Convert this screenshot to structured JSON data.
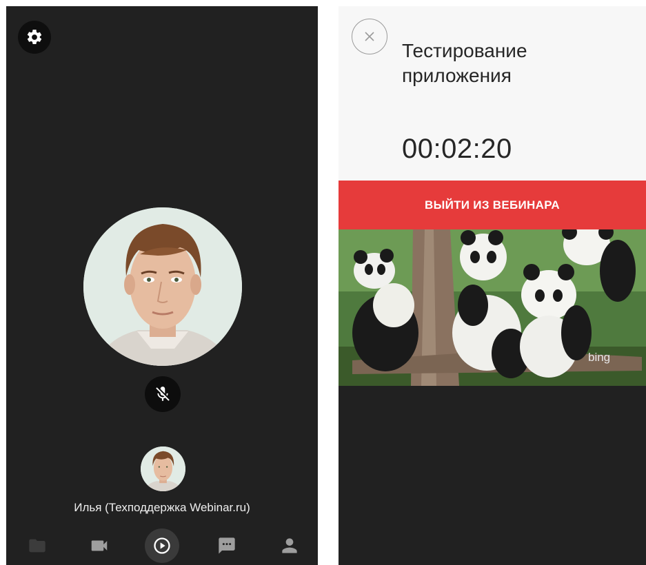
{
  "participant": {
    "name": "Илья (Техподдержка Webinar.ru)"
  },
  "toolbar": {
    "settings_icon": "gear-icon",
    "mic_icon": "mic-off-icon"
  },
  "tabs": [
    {
      "icon": "folder-icon",
      "active": false
    },
    {
      "icon": "video-camera-icon",
      "active": false
    },
    {
      "icon": "play-circle-icon",
      "active": true
    },
    {
      "icon": "chat-icon",
      "active": false
    },
    {
      "icon": "person-icon",
      "active": false
    }
  ],
  "webinar": {
    "title": "Тестирование приложения",
    "timer": "00:02:20",
    "leave_label": "ВЫЙТИ ИЗ ВЕБИНАРА"
  },
  "slide": {
    "watermark": "bing"
  },
  "colors": {
    "dark_bg": "#212121",
    "accent_red": "#e63b3b",
    "header_bg": "#f7f7f7"
  }
}
